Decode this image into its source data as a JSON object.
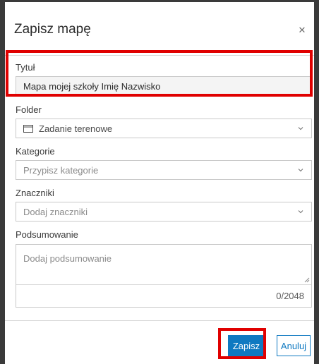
{
  "dialog": {
    "title": "Zapisz mapę",
    "close_icon": "close-icon"
  },
  "fields": {
    "title": {
      "label": "Tytuł",
      "value": "Mapa mojej szkoły Imię Nazwisko"
    },
    "folder": {
      "label": "Folder",
      "value": "Zadanie terenowe",
      "icon": "folder-icon"
    },
    "category": {
      "label": "Kategorie",
      "placeholder": "Przypisz kategorie"
    },
    "tags": {
      "label": "Znaczniki",
      "placeholder": "Dodaj znaczniki"
    },
    "summary": {
      "label": "Podsumowanie",
      "placeholder": "Dodaj podsumowanie",
      "counter": "0/2048"
    }
  },
  "buttons": {
    "save_label": "Zapisz",
    "cancel_label": "Anuluj"
  },
  "colors": {
    "accent": "#0f79c1",
    "highlight": "#e00000"
  }
}
